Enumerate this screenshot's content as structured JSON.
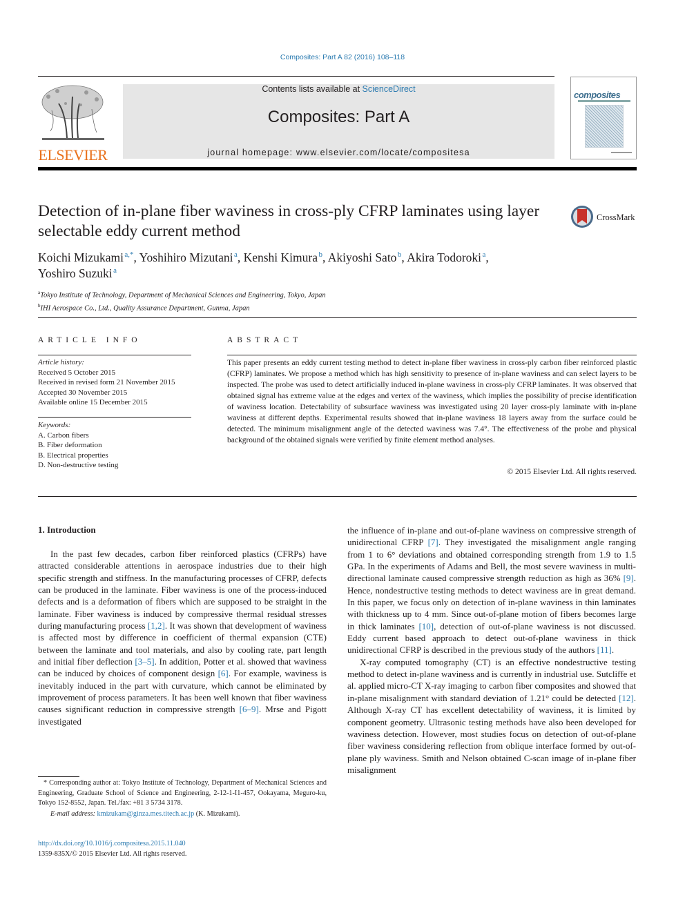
{
  "header": {
    "citation": "Composites: Part A 82 (2016) 108–118",
    "contents_prefix": "Contents lists available at ",
    "contents_link": "ScienceDirect",
    "journal_name": "Composites: Part A",
    "homepage_prefix": "journal homepage: ",
    "homepage_url": "www.elsevier.com/locate/compositesa",
    "publisher": "ELSEVIER",
    "cover_word": "composites",
    "colors": {
      "link": "#2a7ab0",
      "publisher_orange": "#e9711c",
      "banner_bg": "#e6e6e6"
    }
  },
  "article": {
    "title": "Detection of in-plane fiber waviness in cross-ply CFRP laminates using layer selectable eddy current method",
    "crossmark_label": "CrossMark",
    "authors": [
      {
        "name": "Koichi Mizukami",
        "aff": "a,*",
        "sep": ", "
      },
      {
        "name": "Yoshihiro Mizutani",
        "aff": "a",
        "sep": ", "
      },
      {
        "name": "Kenshi Kimura",
        "aff": "b",
        "sep": ", "
      },
      {
        "name": "Akiyoshi Sato",
        "aff": "b",
        "sep": ", "
      },
      {
        "name": "Akira Todoroki",
        "aff": "a",
        "sep": ","
      },
      {
        "name": "Yoshiro Suzuki",
        "aff": "a",
        "sep": ""
      }
    ],
    "affiliations": [
      {
        "key": "a",
        "text": "Tokyo Institute of Technology, Department of Mechanical Sciences and Engineering, Tokyo, Japan"
      },
      {
        "key": "b",
        "text": "IHI Aerospace Co., Ltd., Quality Assurance Department, Gunma, Japan"
      }
    ]
  },
  "article_info": {
    "heading": "ARTICLE INFO",
    "history_label": "Article history:",
    "history": [
      "Received 5 October 2015",
      "Received in revised form 21 November 2015",
      "Accepted 30 November 2015",
      "Available online 15 December 2015"
    ],
    "keywords_label": "Keywords:",
    "keywords": [
      "A. Carbon fibers",
      "B. Fiber deformation",
      "B. Electrical properties",
      "D. Non-destructive testing"
    ]
  },
  "abstract": {
    "heading": "ABSTRACT",
    "text": "This paper presents an eddy current testing method to detect in-plane fiber waviness in cross-ply carbon fiber reinforced plastic (CFRP) laminates. We propose a method which has high sensitivity to presence of in-plane waviness and can select layers to be inspected. The probe was used to detect artificially induced in-plane waviness in cross-ply CFRP laminates. It was observed that obtained signal has extreme value at the edges and vertex of the waviness, which implies the possibility of precise identification of waviness location. Detectability of subsurface waviness was investigated using 20 layer cross-ply laminate with in-plane waviness at different depths. Experimental results showed that in-plane waviness 18 layers away from the surface could be detected. The minimum misalignment angle of the detected waviness was 7.4°. The effectiveness of the probe and physical background of the obtained signals were verified by finite element method analyses.",
    "copyright": "© 2015 Elsevier Ltd. All rights reserved."
  },
  "body": {
    "section_heading": "1. Introduction",
    "left_paragraph": [
      {
        "t": "In the past few decades, carbon fiber reinforced plastics (CFRPs) have attracted considerable attentions in aerospace industries due to their high specific strength and stiffness. In the manufacturing processes of CFRP, defects can be produced in the laminate. Fiber waviness is one of the process-induced defects and is a deformation of fibers which are supposed to be straight in the laminate. Fiber waviness is induced by compressive thermal residual stresses during manufacturing process "
      },
      {
        "ref": "[1,2]"
      },
      {
        "t": ". It was shown that development of waviness is affected most by difference in coefficient of thermal expansion (CTE) between the laminate and tool materials, and also by cooling rate, part length and initial fiber deflection "
      },
      {
        "ref": "[3–5]"
      },
      {
        "t": ". In addition, Potter et al. showed that waviness can be induced by choices of component design "
      },
      {
        "ref": "[6]"
      },
      {
        "t": ". For example, waviness is inevitably induced in the part with curvature, which cannot be eliminated by improvement of process parameters. It has been well known that fiber waviness causes significant reduction in compressive strength "
      },
      {
        "ref": "[6–9]"
      },
      {
        "t": ". Mrse and Pigott investigated"
      }
    ],
    "right_paragraph_1": [
      {
        "t": "the influence of in-plane and out-of-plane waviness on compressive strength of unidirectional CFRP "
      },
      {
        "ref": "[7]"
      },
      {
        "t": ". They investigated the misalignment angle ranging from 1 to 6° deviations and obtained corresponding strength from 1.9 to 1.5 GPa. In the experiments of Adams and Bell, the most severe waviness in multi-directional laminate caused compressive strength reduction as high as 36% "
      },
      {
        "ref": "[9]"
      },
      {
        "t": ". Hence, nondestructive testing methods to detect waviness are in great demand. In this paper, we focus only on detection of in-plane waviness in thin laminates with thickness up to 4 mm. Since out-of-plane motion of fibers becomes large in thick laminates "
      },
      {
        "ref": "[10]"
      },
      {
        "t": ", detection of out-of-plane waviness is not discussed. Eddy current based approach to detect out-of-plane waviness in thick unidirectional CFRP is described in the previous study of the authors "
      },
      {
        "ref": "[11]"
      },
      {
        "t": "."
      }
    ],
    "right_paragraph_2": [
      {
        "t": "X-ray computed tomography (CT) is an effective nondestructive testing method to detect in-plane waviness and is currently in industrial use. Sutcliffe et al. applied micro-CT X-ray imaging to carbon fiber composites and showed that in-plane misalignment with standard deviation of 1.21° could be detected "
      },
      {
        "ref": "[12]"
      },
      {
        "t": ". Although X-ray CT has excellent detectability of waviness, it is limited by component geometry. Ultrasonic testing methods have also been developed for waviness detection. However, most studies focus on detection of out-of-plane fiber waviness considering reflection from oblique interface formed by out-of-plane ply waviness. Smith and Nelson obtained C-scan image of in-plane fiber misalignment"
      }
    ]
  },
  "footnote": {
    "corresponding": "* Corresponding author at: Tokyo Institute of Technology, Department of Mechanical Sciences and Engineering, Graduate School of Science and Engineering, 2-12-1-I1-457, Ookayama, Meguro-ku, Tokyo 152-8552, Japan. Tel./fax: +81 3 5734 3178.",
    "email_label": "E-mail address: ",
    "email": "kmizukam@ginza.mes.titech.ac.jp",
    "email_owner": " (K. Mizukami).",
    "doi": "http://dx.doi.org/10.1016/j.compositesa.2015.11.040",
    "issn_line": "1359-835X/© 2015 Elsevier Ltd. All rights reserved."
  }
}
